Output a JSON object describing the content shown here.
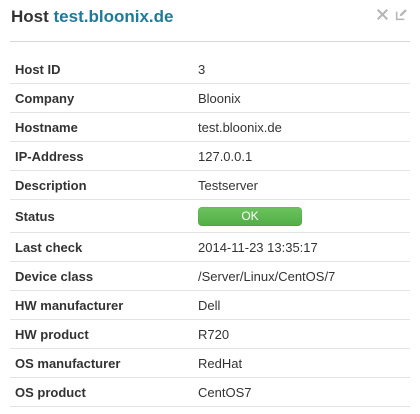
{
  "header": {
    "title_prefix": "Host",
    "host_name": "test.bloonix.de",
    "actions": [
      {
        "name": "close-icon"
      },
      {
        "name": "edit-icon"
      }
    ]
  },
  "details": {
    "rows": [
      {
        "label": "Host ID",
        "value": "3"
      },
      {
        "label": "Company",
        "value": "Bloonix"
      },
      {
        "label": "Hostname",
        "value": "test.bloonix.de"
      },
      {
        "label": "IP-Address",
        "value": "127.0.0.1"
      },
      {
        "label": "Description",
        "value": "Testserver"
      },
      {
        "label": "Status",
        "value": "OK"
      },
      {
        "label": "Last check",
        "value": "2014-11-23 13:35:17"
      },
      {
        "label": "Device class",
        "value": "/Server/Linux/CentOS/7"
      },
      {
        "label": "HW manufacturer",
        "value": "Dell"
      },
      {
        "label": "HW product",
        "value": "R720"
      },
      {
        "label": "OS manufacturer",
        "value": "RedHat"
      },
      {
        "label": "OS product",
        "value": "CentOS7"
      }
    ]
  },
  "colors": {
    "host_name": "#1f7a99",
    "status_ok": "#5cb852",
    "label_text": "#333333",
    "icon_gray": "#b5b5b5",
    "divider": "#d6d6d6"
  }
}
